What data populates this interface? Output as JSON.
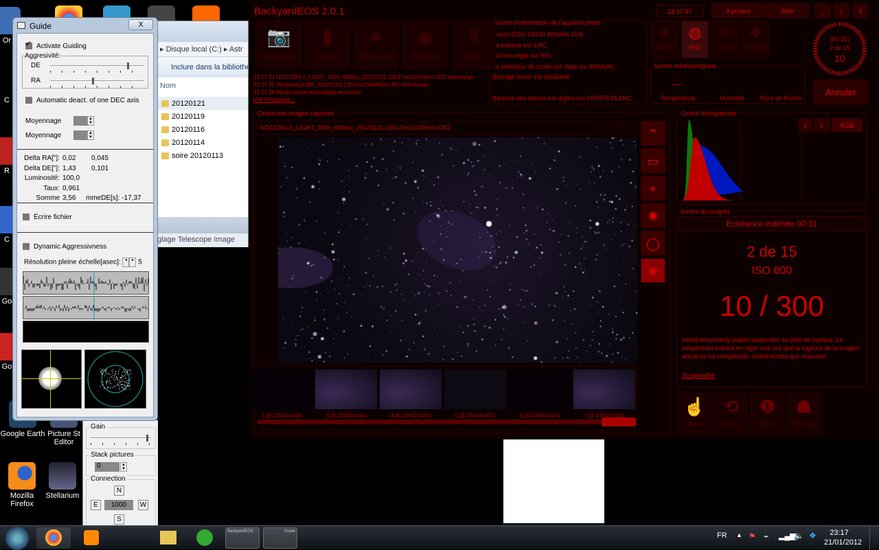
{
  "desktop": {
    "icons": [
      {
        "label": "Or"
      },
      {
        "label": "C"
      },
      {
        "label": "R"
      },
      {
        "label": "C"
      },
      {
        "label": "Goo"
      },
      {
        "label": "Go"
      },
      {
        "label": "Google Earth"
      },
      {
        "label": "Picture St Editor"
      },
      {
        "label": "Mozilla Firefox"
      },
      {
        "label": "Stellarium"
      }
    ]
  },
  "explorer": {
    "breadcrumb": [
      "Disque local (C:)",
      "Astr"
    ],
    "include_label": "Inclure dans la bibliothè",
    "column_header": "Nom",
    "folders": [
      "20120121",
      "20120119",
      "20120116",
      "20120114",
      "soire 20120113"
    ],
    "tabs": "glage  Telescope  Image"
  },
  "guide": {
    "title": "Guide",
    "close_label": "X",
    "activate_guiding": "Activate Guiding",
    "aggressivity_label": "Aggresivité:",
    "de_label": "DE",
    "ra_label": "RA",
    "de_value": 0.82,
    "ra_value": 0.45,
    "auto_deact": "Automatic deact. of one DEC axis",
    "moyennage_ra": "Moyennage",
    "moyennage_de": "Moyennage",
    "stats": [
      {
        "label": "Delta RA[\"]:",
        "v1": "0,02",
        "v2": "0,045"
      },
      {
        "label": "Delta DE[\"]:",
        "v1": "1,43",
        "v2": "0,101"
      },
      {
        "label": "Luminosité:",
        "v1": "100,0",
        "v2": ""
      },
      {
        "label": "Taux:",
        "v1": "0,961",
        "v2": ""
      },
      {
        "label": "Somme",
        "v1": "3,56",
        "v2": "mmeDE[s]:  -17,37"
      }
    ],
    "write_file": "Écrire fichier",
    "dynamic": "Dynamic Aggressivness",
    "resolution_label": "Résolution pleine échelle[asec]:",
    "resolution_value": "5"
  },
  "phd_lower": {
    "gain_label": "Gain",
    "gain_value": 0.92,
    "stack_label": "Stack pictures",
    "stack_value": "0",
    "connection_label": "Connection",
    "n": "N",
    "e": "E",
    "w": "W",
    "s": "S",
    "step": "1000"
  },
  "bye": {
    "title": "BackyardEOS 2.0.1",
    "clock": "23:17:47",
    "apropos": "A propos",
    "aide": "Aide",
    "min": "_",
    "max": "|",
    "close": "X",
    "toolbar": [
      {
        "label": "Déconnecter",
        "icon": "camera-icon"
      },
      {
        "label": "Capturer",
        "icon": "film-icon"
      },
      {
        "label": "Mise au point",
        "icon": "planet-icon"
      },
      {
        "label": "Planétaire",
        "icon": "eye-icon"
      },
      {
        "label": "Aligner",
        "icon": "snake-icon"
      }
    ],
    "log": [
      "23:17:31  NGC2264-1_LIGHT_300s_800iso_20120121-23h17m31s706ms.CR2 téléchargé",
      "23:17:31  Temporary1380_20120121-23h17m29s446ms.JPG téléchargé",
      "23:17:34  Miroir virtuel verrouillage est activé"
    ],
    "history_link": "Voir l'historique...",
    "camera_info": {
      "title": "Centre d'information de l'appareil photo",
      "lines": [
        "Canon EOS 1000D    (Modèle 254)",
        "La batterie est à AC",
        "ISO est réglé sur 800",
        "Le sélecteur de mode est réglé sur MANUAL",
        "Blocage miroir est désactivé",
        "",
        "Balance des blancs est réglée sur PAPIER BLANC"
      ]
    },
    "plugins": [
      {
        "label": "ASCOM",
        "icon": "network-icon"
      },
      {
        "label": "PHD",
        "icon": "phd-icon",
        "active": true
      },
      {
        "label": "Lunaire",
        "icon": "sun-icon"
      },
      {
        "label": "Paramètres",
        "icon": "puzzle-icon"
      }
    ],
    "weather": {
      "title": "Centre météorologique",
      "value": "---",
      "labels": [
        "Température",
        "Humidité",
        "Point de Rosée"
      ]
    },
    "dial": {
      "time": "(00:31)",
      "count": "2 de 15",
      "seconds": "10"
    },
    "cancel": "Annuler",
    "images": {
      "title": "Centre des images capturés",
      "filename": "NGC2264-2_LIGHT_300s_800iso_20120121-23h17m31s706ms.CR2",
      "zoom": "100%",
      "thumbs": [
        "2 @ 22h41m40s",
        "3 @ 22h44m14s",
        "4 @ 22h52m27s",
        "5 @ 23h01m57s",
        "6 @ 23h02m17s",
        "7 @ 23h17m32s"
      ],
      "side_tools": [
        "zoom-fit-icon",
        "screen-icon",
        "crosshair-icon",
        "focus-icon",
        "ring-icon",
        "paw-icon"
      ]
    },
    "histogram": {
      "title": "Centre histogramme",
      "buttons": [
        "2",
        "L",
        "RGB"
      ]
    },
    "progress": {
      "title": "Centre du progrès",
      "eta": "Echéance estimée 00:31",
      "count": "2 de 15",
      "iso": "ISO 800",
      "exposure": "10 / 300",
      "exposure_fraction": 0.033,
      "message": "Usted temporarily puede suspender su plan de captura. La suspensión entrará en vigor una vez que la captura de la imagen actual se ha completado. Usted tendrá que reanudar",
      "suspend": "Suspendre"
    },
    "bottom_tools": [
      {
        "label": "Capturer",
        "glyph": "☝"
      },
      {
        "label": "Boucler",
        "glyph": "⟲"
      },
      {
        "label": "Aperçu",
        "glyph": "❶"
      },
      {
        "label": "Test Caldo",
        "glyph": "☗"
      }
    ],
    "accent": "#cc0000"
  },
  "taskbar": {
    "lang": "FR",
    "time": "23:17",
    "date": "21/01/2012",
    "apps": [
      "BackyardEOS",
      "Guide"
    ]
  }
}
